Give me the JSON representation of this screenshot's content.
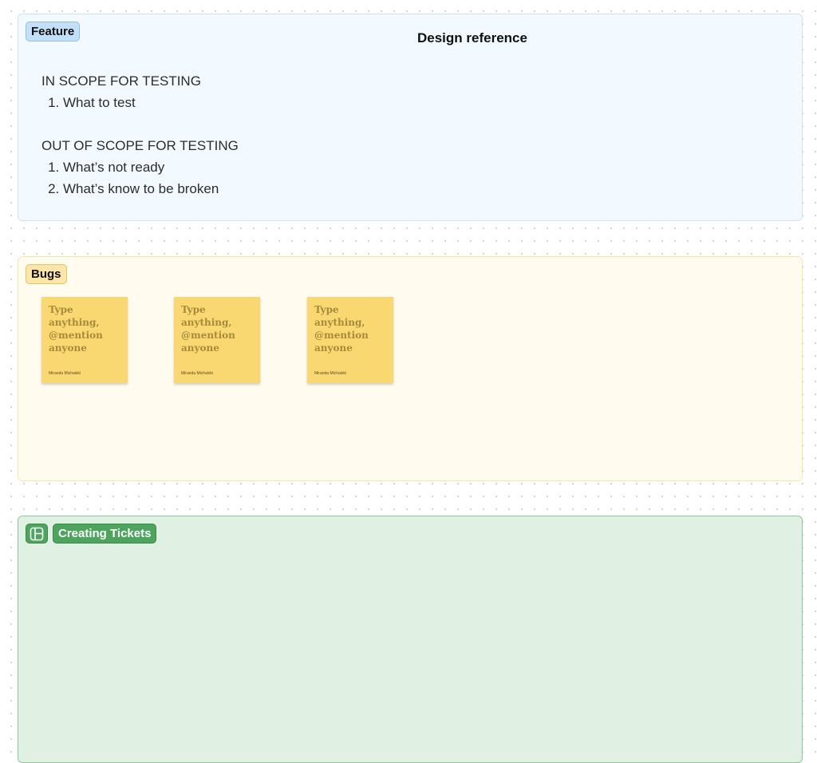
{
  "feature_section": {
    "tag": "Feature",
    "title": "Design reference",
    "in_scope": {
      "heading": "IN SCOPE FOR TESTING",
      "items": [
        "What to test"
      ]
    },
    "out_scope": {
      "heading": "OUT OF SCOPE FOR TESTING",
      "items": [
        "What’s not ready",
        "What’s know to be broken"
      ]
    }
  },
  "bugs_section": {
    "tag": "Bugs",
    "stickies": [
      {
        "text": "Type anything, @mention anyone",
        "author": "Miranda Michalski"
      },
      {
        "text": "Type anything, @mention anyone",
        "author": "Miranda Michalski"
      },
      {
        "text": "Type anything, @mention anyone",
        "author": "Miranda Michalski"
      }
    ]
  },
  "tickets_section": {
    "tag": "Creating Tickets",
    "icon": "layout-template-icon"
  },
  "colors": {
    "feature_bg": "#f2f9ff",
    "bugs_bg": "#fffcef",
    "tickets_bg": "#e0f1e4",
    "sticky": "#f9d872",
    "tickets_accent": "#4da55d"
  }
}
